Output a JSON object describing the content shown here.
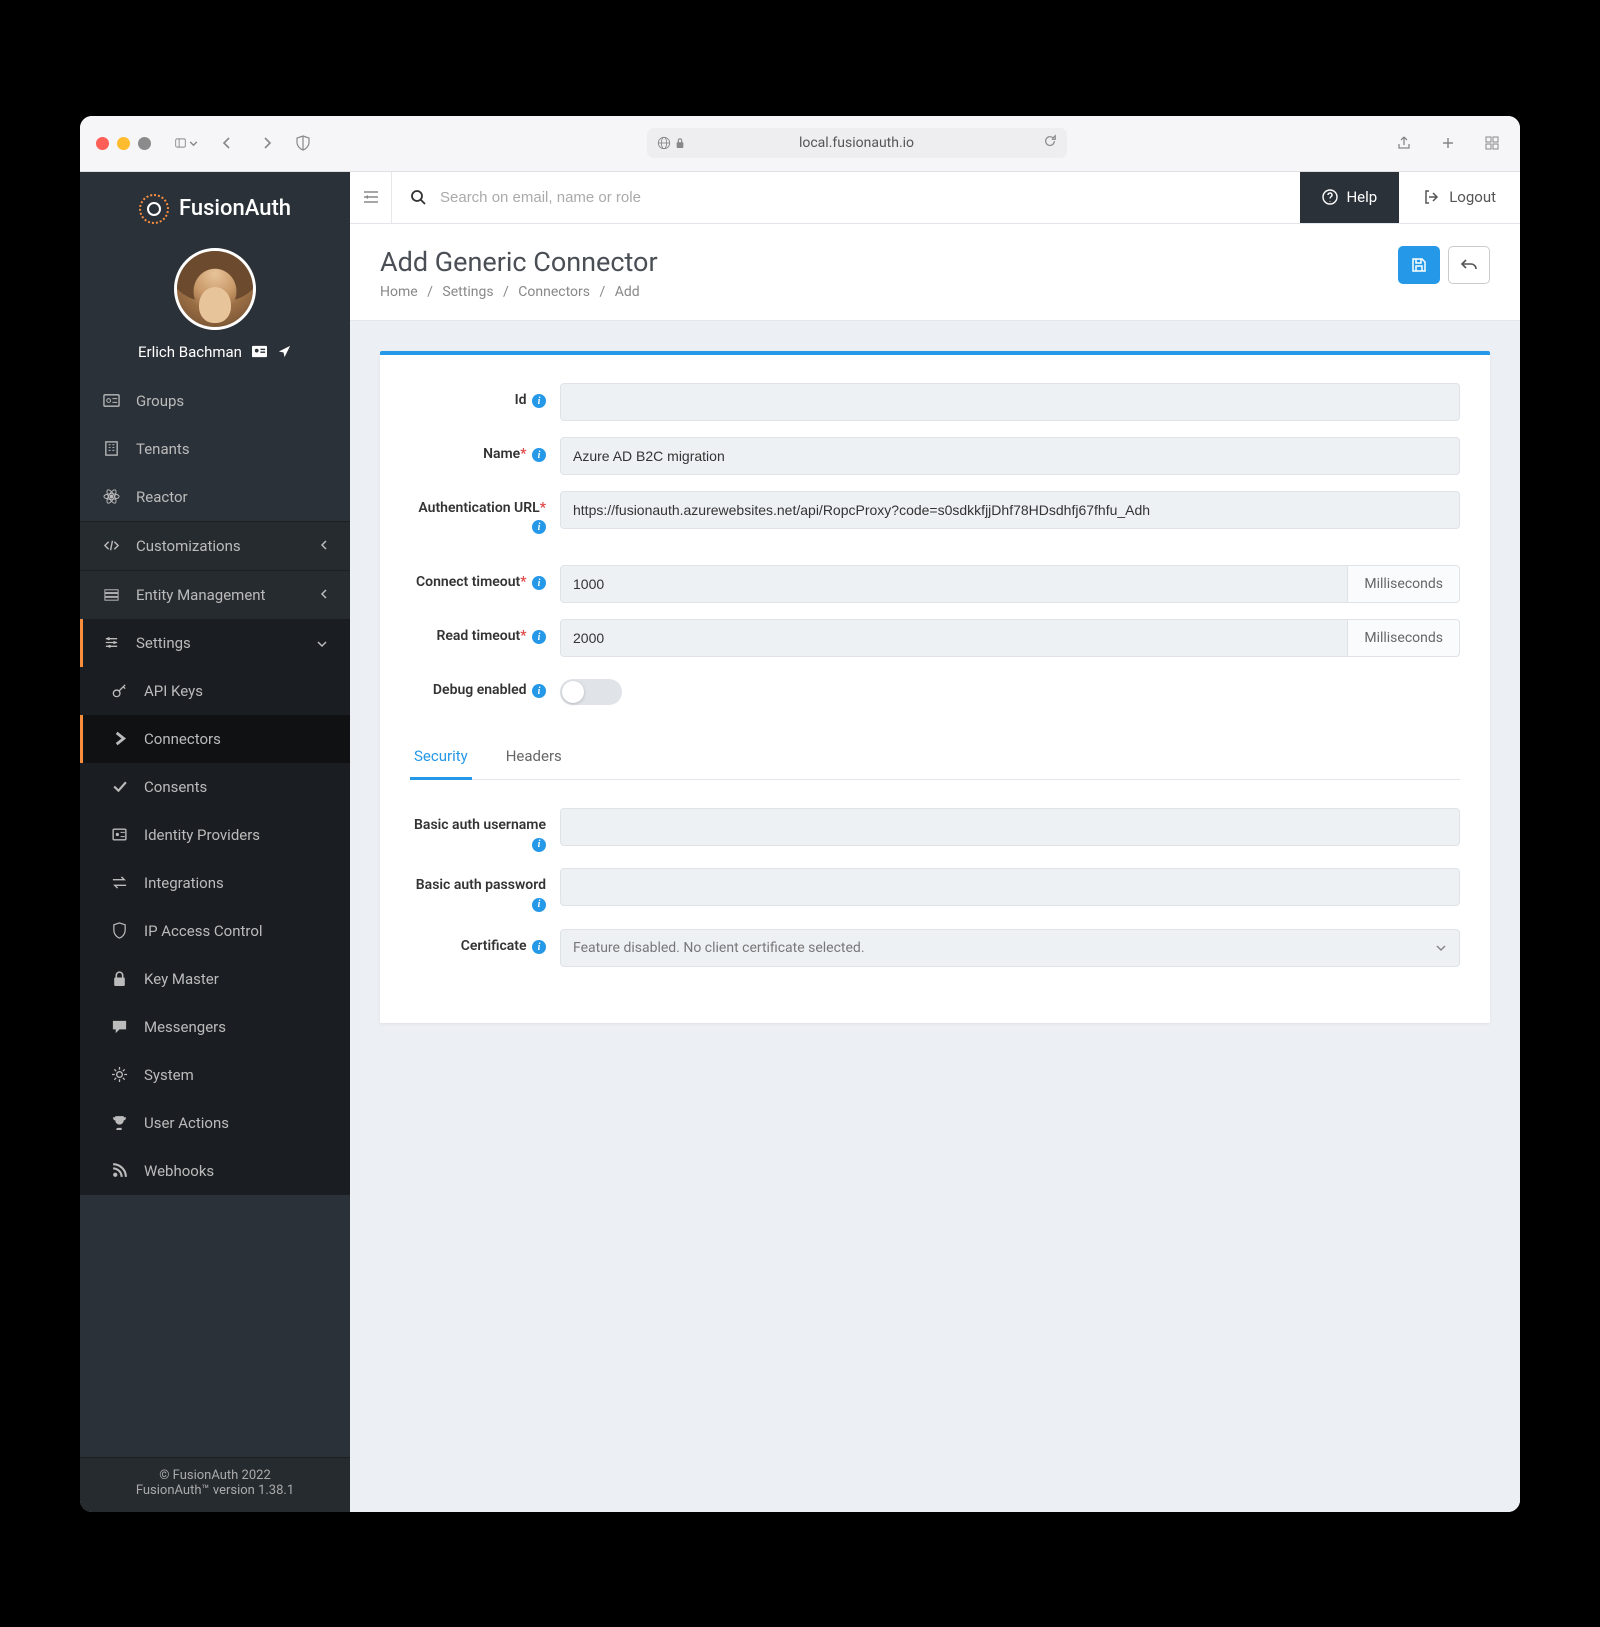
{
  "browser": {
    "url": "local.fusionauth.io"
  },
  "brand": "FusionAuth",
  "user": {
    "name": "Erlich Bachman"
  },
  "topbar": {
    "search_placeholder": "Search on email, name or role",
    "help_label": "Help",
    "logout_label": "Logout"
  },
  "page": {
    "title": "Add Generic Connector",
    "crumbs": [
      "Home",
      "Settings",
      "Connectors",
      "Add"
    ]
  },
  "sidebar": {
    "items": [
      {
        "label": "Groups"
      },
      {
        "label": "Tenants"
      },
      {
        "label": "Reactor"
      }
    ],
    "sections": [
      {
        "label": "Customizations"
      },
      {
        "label": "Entity Management"
      },
      {
        "label": "Settings"
      }
    ],
    "settings_subs": [
      {
        "label": "API Keys"
      },
      {
        "label": "Connectors"
      },
      {
        "label": "Consents"
      },
      {
        "label": "Identity Providers"
      },
      {
        "label": "Integrations"
      },
      {
        "label": "IP Access Control"
      },
      {
        "label": "Key Master"
      },
      {
        "label": "Messengers"
      },
      {
        "label": "System"
      },
      {
        "label": "User Actions"
      },
      {
        "label": "Webhooks"
      }
    ]
  },
  "footer": {
    "copyright": "© FusionAuth 2022",
    "version": "FusionAuth™ version 1.38.1"
  },
  "form": {
    "id_label": "Id",
    "name_label": "Name",
    "name_value": "Azure AD B2C migration",
    "auth_url_label": "Authentication URL",
    "auth_url_value": "https://fusionauth.azurewebsites.net/api/RopcProxy?code=s0sdkkfjjDhf78HDsdhfj67fhfu_Adh",
    "connect_timeout_label": "Connect timeout",
    "connect_timeout_value": "1000",
    "read_timeout_label": "Read timeout",
    "read_timeout_value": "2000",
    "timeout_unit": "Milliseconds",
    "debug_label": "Debug enabled",
    "tabs": [
      "Security",
      "Headers"
    ],
    "basic_user_label": "Basic auth username",
    "basic_pass_label": "Basic auth password",
    "cert_label": "Certificate",
    "cert_value": "Feature disabled. No client certificate selected."
  }
}
